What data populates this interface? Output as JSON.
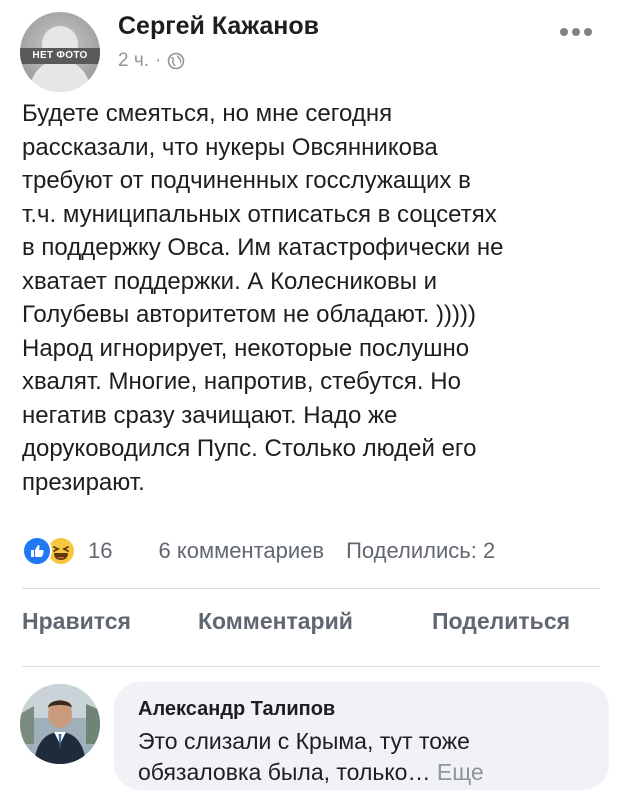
{
  "post": {
    "author": "Сергей Кажанов",
    "avatar_label": "НЕТ ФОТО",
    "time": "2 ч.",
    "separator": "·",
    "privacy_icon": "globe-icon",
    "more_icon": "more-options-icon",
    "text": "Будете смеяться, но мне сегодня\nрассказали, что нукеры Овсянникова\nтребуют от подчиненных госслужащих в\nт.ч. муниципальных отписаться в соцсетях\nв поддержку Овса. Им катастрофически не\nхватает поддержки. А Колесниковы и\nГолубевы авторитетом не обладают. )))))\nНарод игнорирует, некоторые послушно\nхвалят. Многие, напротив, стебутся. Но\nнегатив сразу зачищают. Надо же\nдоруководился Пупс. Столько людей его\nпрезирают."
  },
  "stats": {
    "reactions_count": "16",
    "comments": "6 комментариев",
    "shares": "Поделились: 2",
    "reaction_icons": [
      "like-icon",
      "haha-icon"
    ],
    "like_color": "#2078f4",
    "haha_color": "#f7c742"
  },
  "actions": {
    "like": "Нравится",
    "comment": "Комментарий",
    "share": "Поделиться"
  },
  "comment": {
    "author": "Александр Талипов",
    "text": "Это слизали с Крыма, тут тоже обязаловка была, только…",
    "see_more": "Еще"
  }
}
